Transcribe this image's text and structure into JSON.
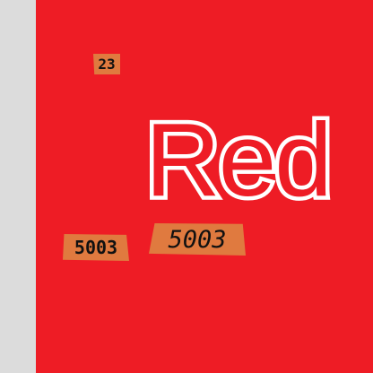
{
  "scene": {
    "brand_word": "Red",
    "colors": {
      "background": "#dcdcdc",
      "panel": "#ee1c25",
      "word": "#ffffff",
      "tag": "#e07a3f",
      "tag_text": "#111111"
    }
  },
  "tags": {
    "top": "23",
    "left": "5003",
    "right": "5003"
  }
}
